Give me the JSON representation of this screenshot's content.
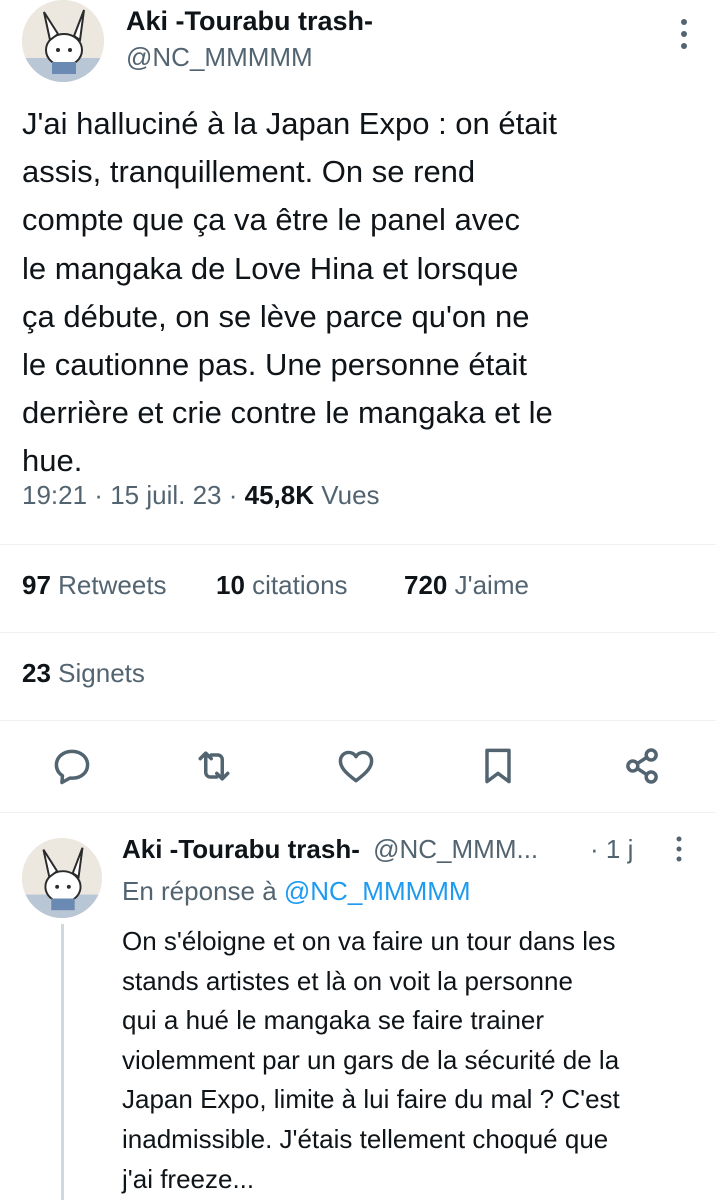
{
  "tweet": {
    "author": {
      "display_name": "Aki -Tourabu trash-",
      "handle": "@NC_MMMMM",
      "avatar_icon": "avatar-illustration-icon"
    },
    "text": "J'ai halluciné à la Japan Expo : on était\nassis, tranquillement. On se rend\ncompte que ça va être le panel avec\nle mangaka de Love Hina et lorsque\nça débute, on se lève parce qu'on ne\nle cautionne pas. Une personne était\nderrière et crie contre le mangaka et le\nhue.",
    "time": "19:21",
    "separator": " · ",
    "date": "15 juil. 23",
    "views_count": "45,8K",
    "views_label": "Vues",
    "stats": {
      "retweets_count": "97",
      "retweets_label": "Retweets",
      "quotes_count": "10",
      "quotes_label": "citations",
      "likes_count": "720",
      "likes_label": "J'aime",
      "bookmarks_count": "23",
      "bookmarks_label": "Signets"
    },
    "actions": [
      "reply-icon",
      "retweet-icon",
      "like-icon",
      "bookmark-icon",
      "share-icon"
    ]
  },
  "reply": {
    "author": {
      "display_name": "Aki -Tourabu trash-",
      "handle": "@NC_MMM...",
      "time": "· 1 j"
    },
    "reply_to_prefix": "En réponse à ",
    "reply_to_handle": "@NC_MMMMM",
    "text": "On s'éloigne et on va faire un tour dans les\nstands artistes et là on voit la personne\nqui a hué le mangaka se faire trainer\nviolemment par un gars de la sécurité de la\nJapan Expo, limite à lui faire du mal ? C'est\ninadmissible. J'étais tellement choqué que\nj'ai freeze..."
  },
  "colors": {
    "text": "#0f1419",
    "secondary": "#536471",
    "link": "#1d9bf0",
    "divider": "#eff3f4"
  }
}
